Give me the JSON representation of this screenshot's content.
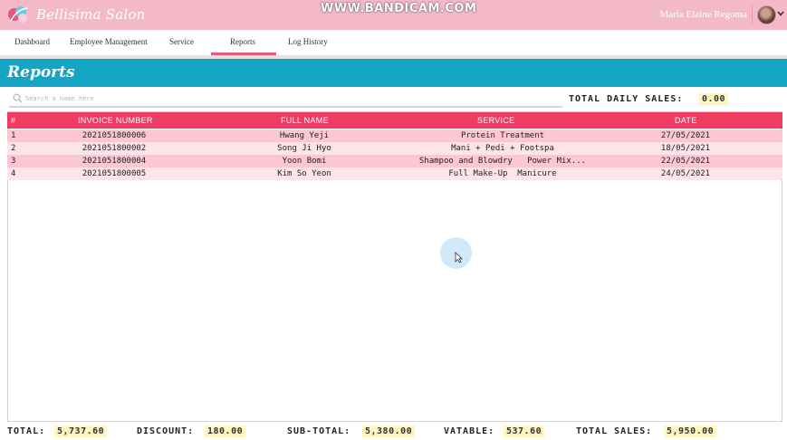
{
  "header": {
    "brand": "Bellisima Salon",
    "watermark": "WWW.BANDICAM.COM",
    "user_name": "Maria Elaine Regoma"
  },
  "nav": {
    "items": [
      {
        "label": "Dashboard"
      },
      {
        "label": "Employee Management"
      },
      {
        "label": "Service"
      },
      {
        "label": "Reports"
      },
      {
        "label": "Log History"
      }
    ],
    "active": "Reports"
  },
  "page": {
    "title": "Reports"
  },
  "search": {
    "placeholder": "Search a name here",
    "value": ""
  },
  "daily_sales": {
    "label": "TOTAL DAILY SALES:",
    "value": "0.00"
  },
  "table": {
    "columns": [
      "#",
      "INVOICE NUMBER",
      "FULL NAME",
      "SERVICE",
      "DATE"
    ],
    "rows": [
      {
        "num": "1",
        "invoice": "2021051800006",
        "name": "Hwang Yeji",
        "service": "Protein Treatment",
        "date": "27/05/2021"
      },
      {
        "num": "2",
        "invoice": "2021051800002",
        "name": "Song Ji Hyo",
        "service": "Mani + Pedi + Footspa",
        "date": "18/05/2021"
      },
      {
        "num": "3",
        "invoice": "2021051800004",
        "name": "Yoon Bomi",
        "service": "Shampoo and Blowdry   Power Mix...",
        "date": "22/05/2021"
      },
      {
        "num": "4",
        "invoice": "2021051800005",
        "name": "Kim So Yeon",
        "service": "Full Make-Up  Manicure",
        "date": "24/05/2021"
      }
    ]
  },
  "footer": {
    "total_label": "TOTAL:",
    "total_value": "5,737.60",
    "discount_label": "DISCOUNT:",
    "discount_value": "180.00",
    "subtotal_label": "SUB-TOTAL:",
    "subtotal_value": "5,380.00",
    "vatable_label": "VATABLE:",
    "vatable_value": "537.60",
    "total_sales_label": "TOTAL SALES:",
    "total_sales_value": "5,950.00"
  },
  "colors": {
    "header_pink": "#f4b9c9",
    "banner_blue": "#14a5c5",
    "table_header": "#f03b62",
    "row_odd": "#fbc7d3",
    "row_even": "#fde3ea",
    "value_highlight": "#fff5bf",
    "nav_active": "#e8567a"
  },
  "icons": {
    "logo": "salon-logo-icon",
    "search": "search-icon",
    "caret": "chevron-down-icon",
    "cursor": "mouse-pointer-icon"
  }
}
